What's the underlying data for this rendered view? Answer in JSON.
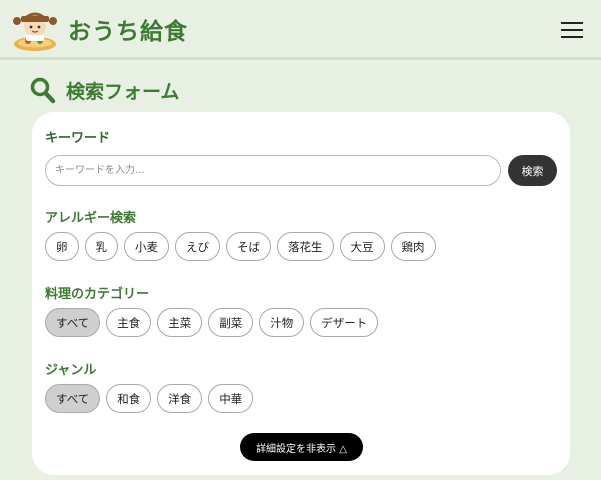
{
  "header": {
    "app_title": "おうち給食"
  },
  "section": {
    "title": "検索フォーム"
  },
  "keyword": {
    "label": "キーワード",
    "placeholder": "キーワードを入力...",
    "search_button": "検索"
  },
  "allergy": {
    "label": "アレルギー検索",
    "chips": [
      "卵",
      "乳",
      "小麦",
      "えび",
      "そば",
      "落花生",
      "大豆",
      "鶏肉"
    ]
  },
  "category": {
    "label": "料理のカテゴリー",
    "chips": [
      "すべて",
      "主食",
      "主菜",
      "副菜",
      "汁物",
      "デザート"
    ],
    "selected": "すべて"
  },
  "genre": {
    "label": "ジャンル",
    "chips": [
      "すべて",
      "和食",
      "洋食",
      "中華"
    ],
    "selected": "すべて"
  },
  "toggle_details": {
    "label": "詳細設定を非表示 △"
  },
  "colors": {
    "brand_green": "#3d7a32",
    "page_bg": "#e8f0e4",
    "button_dark": "#333333"
  }
}
